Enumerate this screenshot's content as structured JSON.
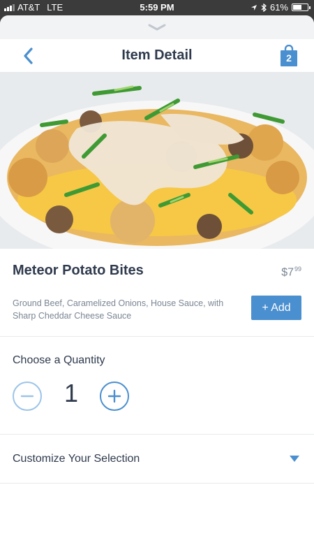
{
  "status_bar": {
    "carrier": "AT&T",
    "network": "LTE",
    "time": "5:59 PM",
    "battery": "61%",
    "battery_level": 0.61
  },
  "nav": {
    "title": "Item Detail",
    "back_icon": "chevron-left-icon",
    "bag_icon": "shopping-bag-icon",
    "bag_count": "2"
  },
  "item": {
    "image_icon": "food-photo",
    "name": "Meteor Potato Bites",
    "price_dollars": "$7",
    "price_cents": "99",
    "description": "Ground Beef, Caramelized Onions, House Sauce, with Sharp Cheddar Cheese Sauce",
    "add_label": "+ Add"
  },
  "quantity": {
    "title": "Choose a Quantity",
    "value": "1",
    "minus_icon": "minus-circle-icon",
    "plus_icon": "plus-circle-icon"
  },
  "customize": {
    "label": "Customize Your Selection",
    "caret_icon": "caret-down-icon"
  },
  "colors": {
    "accent": "#4a8fcf",
    "text": "#2f3a4d",
    "muted": "#7b8694"
  }
}
